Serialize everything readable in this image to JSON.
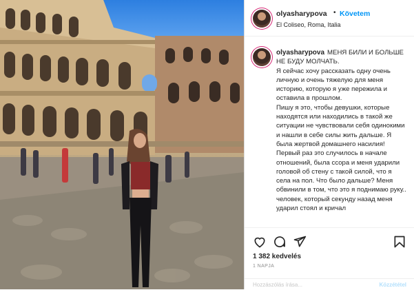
{
  "post": {
    "username": "olyasharypova",
    "separator": "•",
    "follow_label": "Követem",
    "location": "El Coliseo, Roma, Italia"
  },
  "caption": {
    "username": "olyasharypova",
    "title": "МЕНЯ БИЛИ И БОЛЬШЕ НЕ БУДУ МОЛЧАТЬ.",
    "paragraph1": "Я сейчас хочу рассказать одну очень личную и очень тяжелую для меня историю, которую я уже пережила и оставила в прошлом.",
    "paragraph2": "Пишу я это, чтобы девушки, которые находятся или находились в такой же ситуации не чувствовали себя одинокими и нашли в себе силы жить дальше. Я была жертвой домашнего насилия! Первый раз это случилось в начале отношений, была ссора и меня ударили головой об стену с такой силой, что я села на пол. Что было дальше? Меня обвинили в том, что это я поднимаю руку.. человек, который секунду назад меня ударил стоял и кричал"
  },
  "actions": {
    "like_icon": "heart-icon",
    "comment_icon": "comment-icon",
    "share_icon": "share-icon",
    "save_icon": "bookmark-icon"
  },
  "likes_text": "1 382 kedvelés",
  "time_text": "1 NAPJA",
  "comment_box": {
    "placeholder": "Hozzászólás írása...",
    "post_label": "Közzététel"
  },
  "colors": {
    "accent": "#0095f6",
    "sky": "#2d7fe0",
    "stone": "#b9a078"
  }
}
